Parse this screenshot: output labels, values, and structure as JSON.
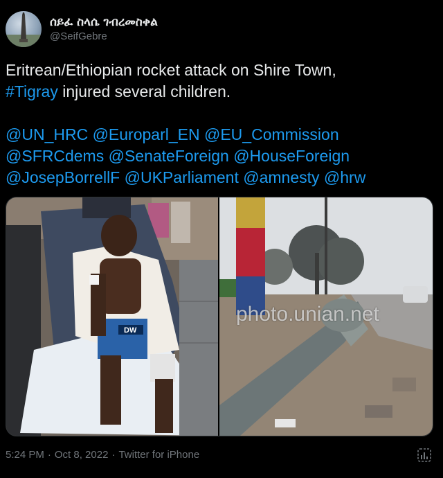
{
  "author": {
    "display_name": "ሰይፈ ስላሴ ገብረመስቀል",
    "handle": "@SeifGebre"
  },
  "tweet": {
    "line1": "Eritrean/Ethiopian rocket attack on Shire Town,",
    "hashtag": "#Tigray",
    "line2_rest": " injured several children.",
    "mentions_line1": "@UN_HRC @Europarl_EN @EU_Commission",
    "mentions_line2": "@SFRCdems @SenateForeign @HouseForeign",
    "mentions_line3": "@JosepBorrellF @UKParliament @amnesty @hrw"
  },
  "media": {
    "left_photo_logo": "DW",
    "right_photo_watermark": "photo.unian.net"
  },
  "meta": {
    "time": "5:24 PM",
    "date": "Oct 8, 2022",
    "source": "Twitter for iPhone",
    "separator": "·"
  },
  "colors": {
    "background": "#000000",
    "text": "#e7e9ea",
    "link": "#1d9bf0",
    "secondary": "#71767b"
  },
  "icons": {
    "analytics": "analytics-icon"
  }
}
